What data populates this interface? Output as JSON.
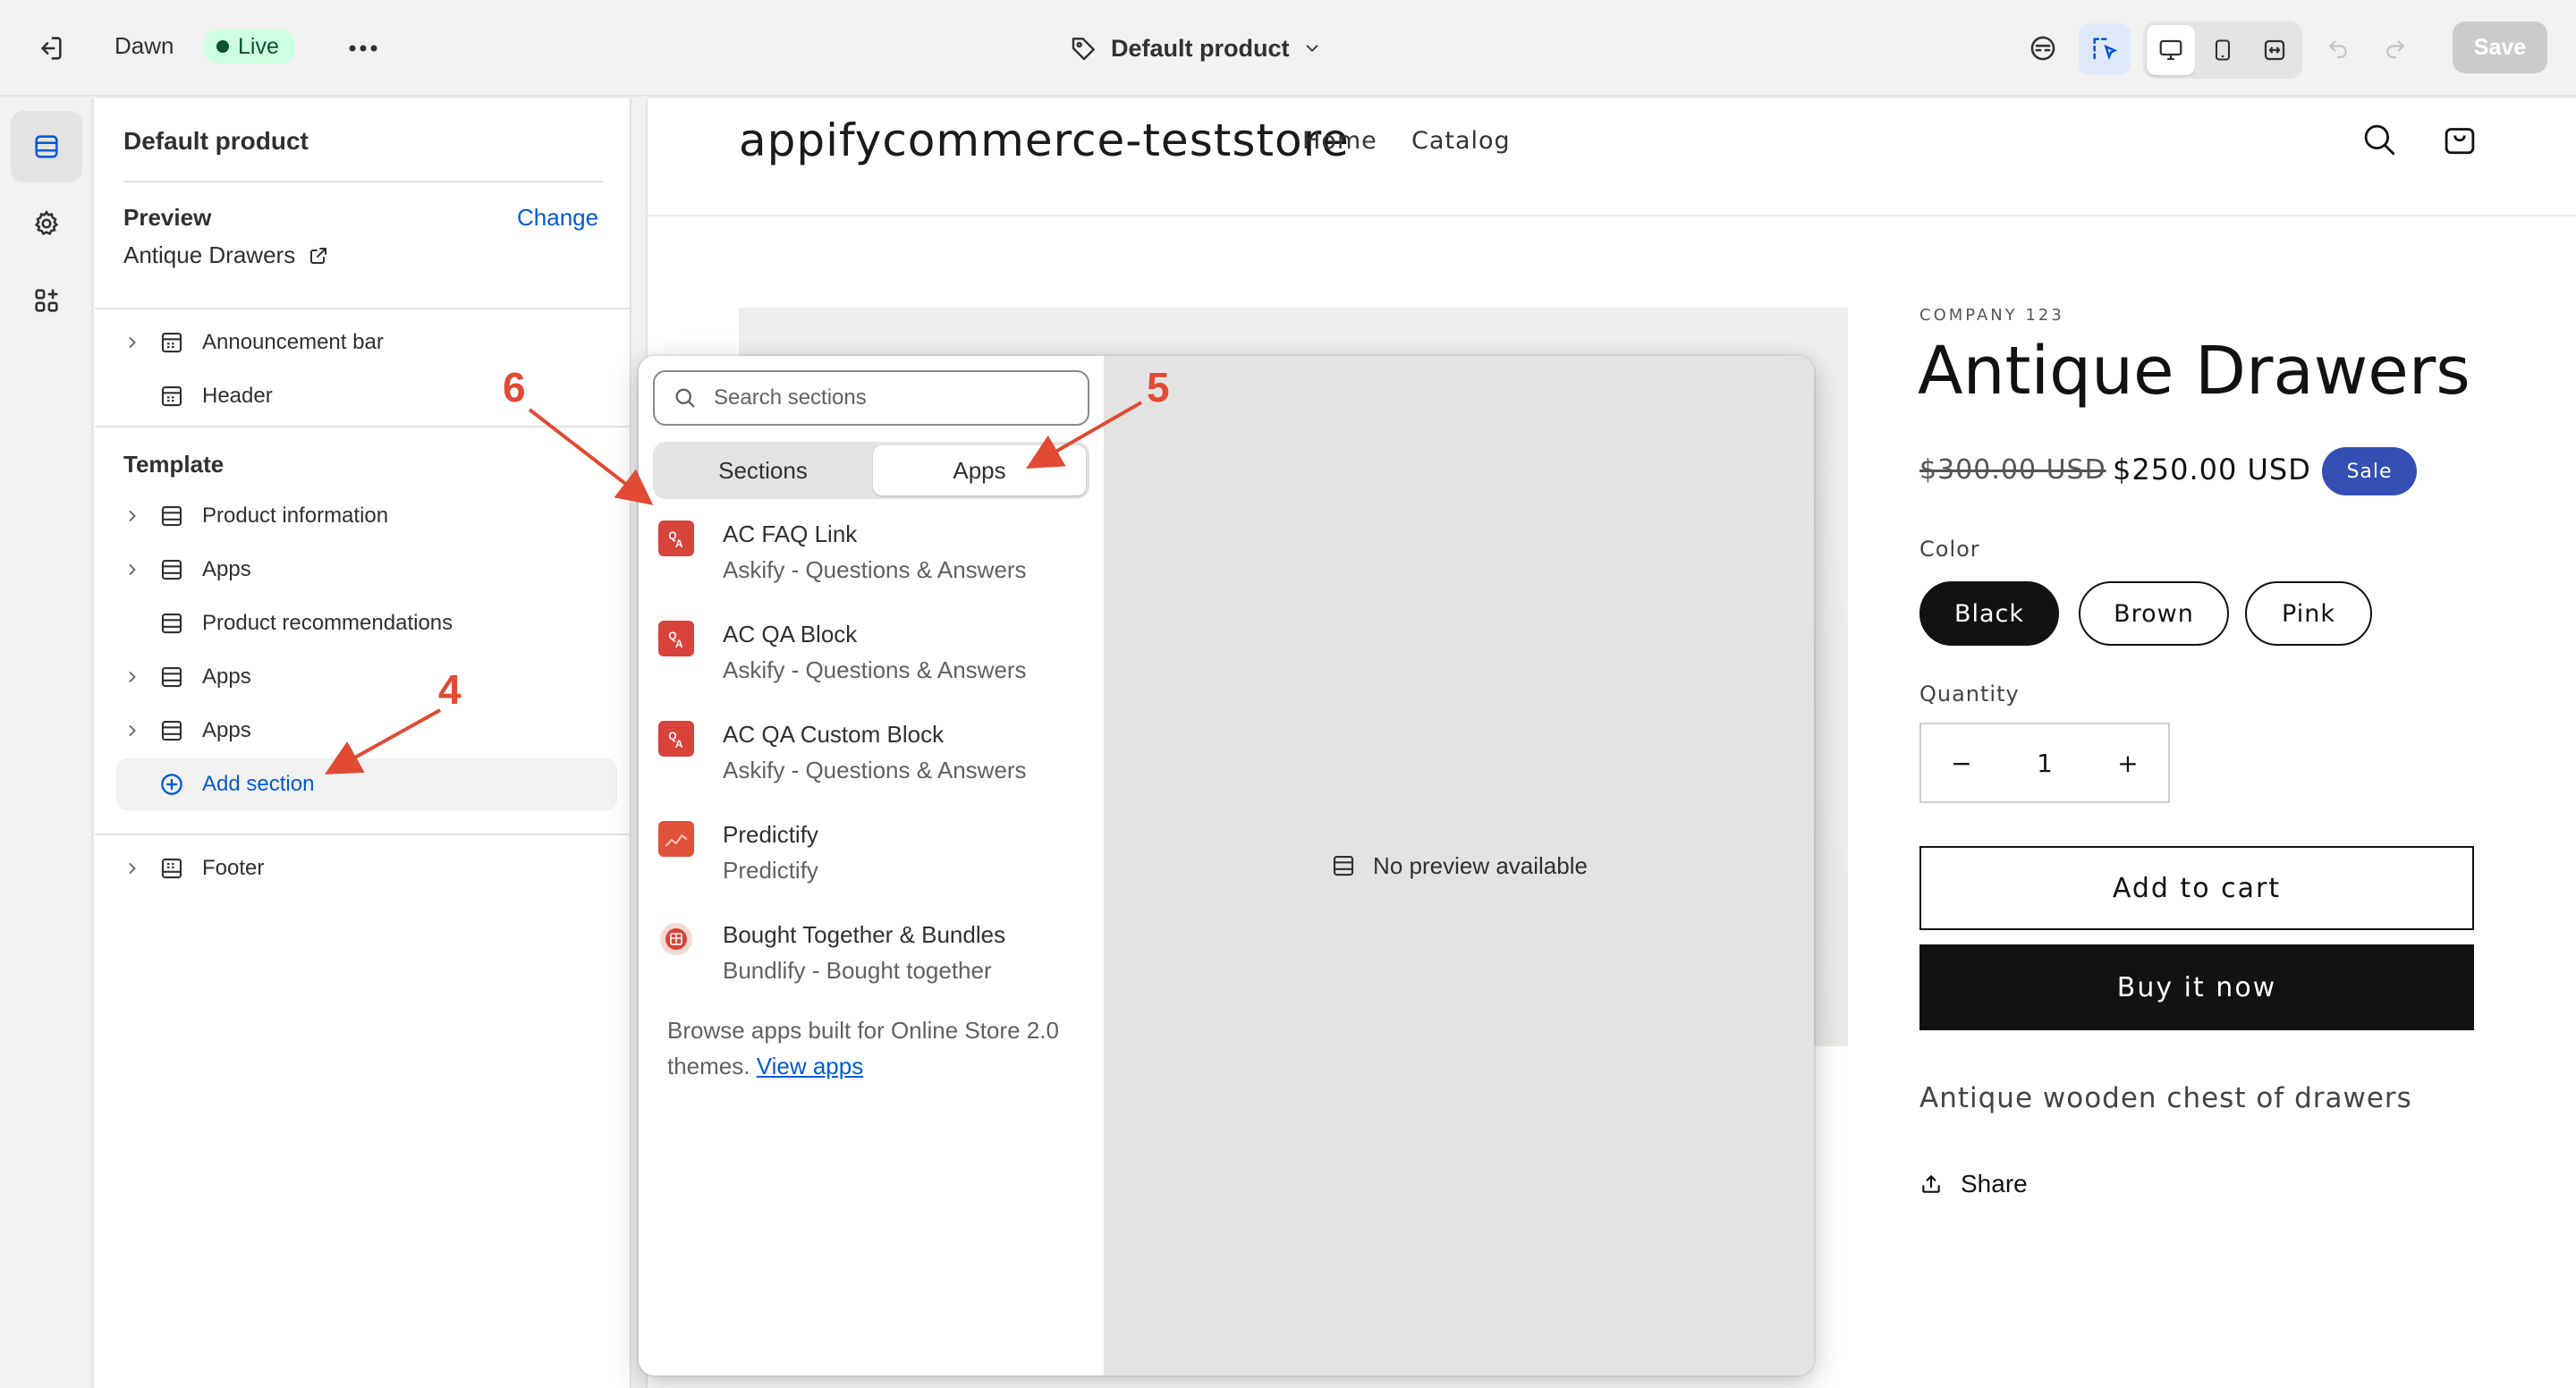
{
  "topbar": {
    "theme_name": "Dawn",
    "live_label": "Live",
    "template_label": "Default product",
    "save_label": "Save"
  },
  "sidebar": {
    "title": "Default product",
    "preview_label": "Preview",
    "change_label": "Change",
    "preview_product": "Antique Drawers",
    "header_group": [
      {
        "label": "Announcement bar",
        "expandable": true
      },
      {
        "label": "Header",
        "expandable": false
      }
    ],
    "template_label": "Template",
    "template_items": [
      {
        "label": "Product information",
        "expandable": true
      },
      {
        "label": "Apps",
        "expandable": true
      },
      {
        "label": "Product recommendations",
        "expandable": false
      },
      {
        "label": "Apps",
        "expandable": true
      },
      {
        "label": "Apps",
        "expandable": true
      }
    ],
    "add_section_label": "Add section",
    "footer_label": "Footer"
  },
  "popup": {
    "search_placeholder": "Search sections",
    "tabs": [
      {
        "label": "Sections",
        "active": false
      },
      {
        "label": "Apps",
        "active": true
      }
    ],
    "apps": [
      {
        "name": "AC FAQ Link",
        "sub": "Askify - Questions & Answers",
        "icon": "askify-icon"
      },
      {
        "name": "AC QA Block",
        "sub": "Askify - Questions & Answers",
        "icon": "askify-icon"
      },
      {
        "name": "AC QA Custom Block",
        "sub": "Askify - Questions & Answers",
        "icon": "askify-icon"
      },
      {
        "name": "Predictify",
        "sub": "Predictify",
        "icon": "predictify-icon"
      },
      {
        "name": "Bought Together & Bundles",
        "sub": "Bundlify - Bought together",
        "icon": "bundlify-icon"
      }
    ],
    "browse_text": "Browse apps built for Online Store 2.0 themes.",
    "view_apps_label": "View apps",
    "no_preview_label": "No preview available"
  },
  "store": {
    "title": "appifycommerce-teststore",
    "nav": [
      "Home",
      "Catalog"
    ],
    "vendor": "COMPANY 123",
    "product_title": "Antique Drawers",
    "price_old": "$300.00 USD",
    "price_new": "$250.00 USD",
    "sale_label": "Sale",
    "color_label": "Color",
    "colors": [
      {
        "label": "Black",
        "selected": true
      },
      {
        "label": "Brown",
        "selected": false
      },
      {
        "label": "Pink",
        "selected": false
      }
    ],
    "quantity_label": "Quantity",
    "quantity_minus": "−",
    "quantity_value": "1",
    "quantity_plus": "+",
    "add_to_cart_label": "Add to cart",
    "buy_now_label": "Buy it now",
    "description": "Antique wooden chest of drawers",
    "share_label": "Share"
  },
  "annotations": [
    "4",
    "5",
    "6"
  ],
  "colors": {
    "accent_blue": "#005bd3",
    "sale_badge": "#334fb4",
    "annotation_red": "#e14a33",
    "live_badge_bg": "#cdfee1",
    "app_icon_red": "#d9443a"
  }
}
